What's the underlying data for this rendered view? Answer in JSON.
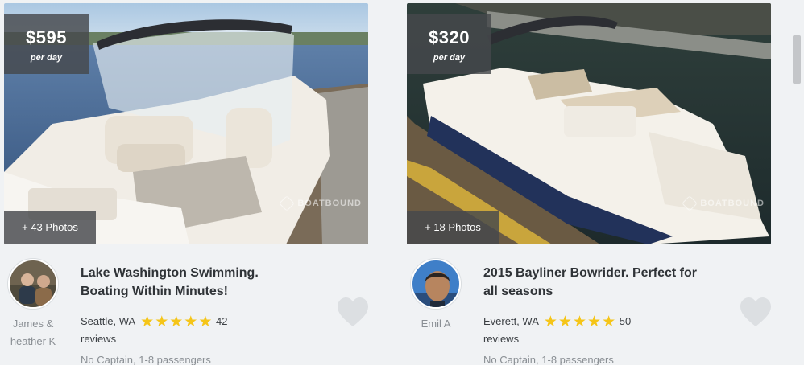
{
  "listings": [
    {
      "price": "$595",
      "price_unit": "per day",
      "photos_label": "+ 43 Photos",
      "watermark": "BOATBOUND",
      "title": "Lake Washington Swimming. Boating Within Minutes!",
      "owner": "James & heather K",
      "location": "Seattle, WA",
      "rating": 5,
      "review_count": "42",
      "reviews_word": "reviews",
      "specs": "No Captain, 1-8 passengers",
      "icons": [
        "star-icon",
        "heart-icon"
      ]
    },
    {
      "price": "$320",
      "price_unit": "per day",
      "photos_label": "+ 18 Photos",
      "watermark": "BOATBOUND",
      "title": "2015 Bayliner Bowrider. Perfect for all seasons",
      "owner": "Emil A",
      "location": "Everett, WA",
      "rating": 5,
      "review_count": "50",
      "reviews_word": "reviews",
      "specs": "No Captain, 1-8 passengers",
      "icons": [
        "star-icon",
        "heart-icon"
      ]
    }
  ],
  "colors": {
    "star": "#f5c518",
    "heart": "#dcdfe2",
    "title_text": "#2f3337",
    "muted_text": "#8a8f94",
    "badge_bg": "#46484c"
  }
}
